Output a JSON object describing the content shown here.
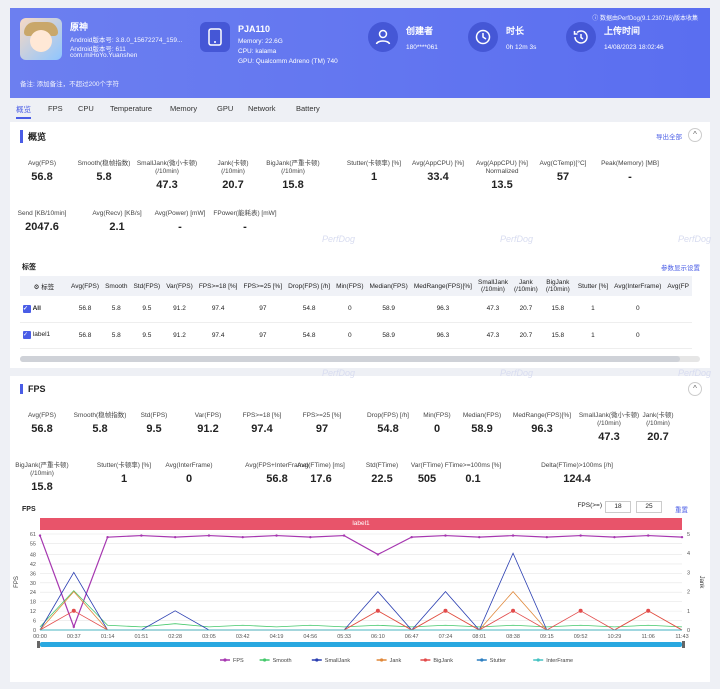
{
  "header": {
    "app": {
      "name": "原神",
      "android_version": "Android版本号: 3.8.0_15672274_159...",
      "android_code": "Android版本号: 611",
      "package": "com.miHoYo.Yuanshen"
    },
    "device": {
      "title": "PJA110",
      "memory": "Memory: 22.6G",
      "cpu": "CPU: kalama",
      "gpu": "GPU: Qualcomm Adreno (TM) 740"
    },
    "creator": {
      "title": "创建者",
      "value": "180****061"
    },
    "duration": {
      "title": "时长",
      "value": "0h 12m 3s"
    },
    "upload": {
      "title": "上传时间",
      "value": "14/08/2023 18:02:46"
    },
    "upload_link": "ⓘ 数据由PerfDog(9.1.230716)版本收集",
    "note": "备注: 添加备注，不超过200个字符"
  },
  "tabs": [
    "概览",
    "FPS",
    "CPU",
    "Temperature",
    "Memory",
    "GPU",
    "Network",
    "Battery"
  ],
  "overview": {
    "title": "概览",
    "export": "导出全部",
    "metrics_row1": [
      {
        "label": "Avg(FPS)",
        "value": "56.8"
      },
      {
        "label": "Smooth(稳帧指数)",
        "value": "5.8"
      },
      {
        "label": "SmallJank(微小卡顿)\n(/10min)",
        "value": "47.3"
      },
      {
        "label": "Jank(卡顿)\n(/10min)",
        "value": "20.7"
      },
      {
        "label": "BigJank(严重卡顿)\n(/10min)",
        "value": "15.8"
      },
      {
        "label": "Stutter(卡顿率) [%]",
        "value": "1"
      },
      {
        "label": "Avg(AppCPU) [%]",
        "value": "33.4"
      },
      {
        "label": "Avg(AppCPU) [%]\nNormalized",
        "value": "13.5"
      },
      {
        "label": "Avg(CTemp)[°C]",
        "value": "57"
      },
      {
        "label": "Peak(Memory) [MB]",
        "value": "-"
      }
    ],
    "metrics_row2": [
      {
        "label": "Send [KB/10min]",
        "value": "2047.6"
      },
      {
        "label": "Avg(Recv) [KB/s]",
        "value": "2.1"
      },
      {
        "label": "Avg(Power) [mW]",
        "value": "-"
      },
      {
        "label": "FPower(能耗表) [mW]",
        "value": "-"
      }
    ],
    "table_title": "标签",
    "table_link": "参数显示设置",
    "columns": [
      "标签",
      "Avg(FPS)",
      "Smooth",
      "Std(FPS)",
      "Var(FPS)",
      "FPS>=18 [%]",
      "FPS>=25 [%]",
      "Drop(FPS) [/h]",
      "Min(FPS)",
      "Median(FPS)",
      "MedRange(FPS)[%]",
      "SmallJank\n(/10min)",
      "Jank\n(/10min)",
      "BigJank\n(/10min)",
      "Stutter [%]",
      "Avg(InterFrame)",
      "Avg(FP"
    ],
    "rows": [
      [
        "All",
        "56.8",
        "5.8",
        "9.5",
        "91.2",
        "97.4",
        "97",
        "54.8",
        "0",
        "58.9",
        "96.3",
        "47.3",
        "20.7",
        "15.8",
        "1",
        "0",
        ""
      ],
      [
        "label1",
        "56.8",
        "5.8",
        "9.5",
        "91.2",
        "97.4",
        "97",
        "54.8",
        "0",
        "58.9",
        "96.3",
        "47.3",
        "20.7",
        "15.8",
        "1",
        "0",
        ""
      ]
    ]
  },
  "fps": {
    "title": "FPS",
    "metrics_row1": [
      {
        "label": "Avg(FPS)",
        "value": "56.8"
      },
      {
        "label": "Smooth(稳帧指数)",
        "value": "5.8"
      },
      {
        "label": "Std(FPS)",
        "value": "9.5"
      },
      {
        "label": "Var(FPS)",
        "value": "91.2"
      },
      {
        "label": "FPS>=18 [%]",
        "value": "97.4"
      },
      {
        "label": "FPS>=25 [%]",
        "value": "97"
      },
      {
        "label": "Drop(FPS) [/h]",
        "value": "54.8"
      },
      {
        "label": "Min(FPS)",
        "value": "0"
      },
      {
        "label": "Median(FPS)",
        "value": "58.9"
      },
      {
        "label": "MedRange(FPS)[%]",
        "value": "96.3"
      },
      {
        "label": "SmallJank(微小卡顿)\n(/10min)",
        "value": "47.3"
      },
      {
        "label": "Jank(卡顿)\n(/10min)",
        "value": "20.7"
      }
    ],
    "metrics_row2": [
      {
        "label": "BigJank(严重卡顿)\n(/10min)",
        "value": "15.8"
      },
      {
        "label": "Stutter(卡顿率) [%]",
        "value": "1"
      },
      {
        "label": "Avg(InterFrame)",
        "value": "0"
      },
      {
        "label": "Avg(FPS+InterFrame)",
        "value": "56.8"
      },
      {
        "label": "Avg(FTime) [ms]",
        "value": "17.6"
      },
      {
        "label": "Std(FTime)",
        "value": "22.5"
      },
      {
        "label": "Var(FTime)",
        "value": "505"
      },
      {
        "label": "FTime>=100ms [%]",
        "value": "0.1"
      },
      {
        "label": "Delta(FTime)>100ms [/h]",
        "value": "124.4"
      }
    ],
    "chart_title": "FPS",
    "fps_threshold_label": "FPS(>=)",
    "fps_threshold_1": "18",
    "fps_threshold_2": "25",
    "reset": "重置",
    "label_bar": "label1"
  },
  "watermark": "PerfDog",
  "chart_data": {
    "type": "line",
    "ylabel": "FPS",
    "y2label": "Jank",
    "ylim": [
      0,
      61
    ],
    "y2lim": [
      0,
      5
    ],
    "yticks": [
      "0",
      "6",
      "12",
      "18",
      "24",
      "30",
      "36",
      "42",
      "48",
      "55",
      "61"
    ],
    "y2ticks": [
      "0",
      "1",
      "2",
      "3",
      "4",
      "5"
    ],
    "x": [
      "00:00",
      "00:37",
      "01:14",
      "01:51",
      "02:28",
      "03:05",
      "03:42",
      "04:19",
      "04:56",
      "05:33",
      "06:10",
      "06:47",
      "07:24",
      "08:01",
      "08:38",
      "09:15",
      "09:52",
      "10:29",
      "11:06",
      "11:43"
    ],
    "series": [
      {
        "name": "FPS",
        "color": "#a637b0",
        "values": [
          60,
          2,
          59,
          60,
          59,
          60,
          59,
          60,
          59,
          60,
          48,
          59,
          60,
          59,
          60,
          59,
          60,
          59,
          60,
          59
        ]
      },
      {
        "name": "Smooth",
        "color": "#44c86b",
        "values": [
          2,
          25,
          3,
          2,
          4,
          2,
          3,
          2,
          3,
          2,
          3,
          2,
          3,
          2,
          3,
          2,
          3,
          2,
          3,
          2
        ]
      },
      {
        "name": "SmallJank",
        "color": "#2a3eb1",
        "values": [
          0,
          3,
          0,
          0,
          1,
          0,
          0,
          0,
          0,
          0,
          2,
          0,
          2,
          0,
          4,
          0,
          0,
          0,
          0,
          0
        ]
      },
      {
        "name": "Jank",
        "color": "#e0883a",
        "values": [
          0,
          2,
          0,
          0,
          0,
          0,
          0,
          0,
          0,
          0,
          1,
          0,
          1,
          0,
          2,
          0,
          0,
          0,
          1,
          0
        ]
      },
      {
        "name": "BigJank",
        "color": "#e24b4b",
        "values": [
          0,
          1,
          0,
          0,
          0,
          0,
          0,
          0,
          0,
          0,
          1,
          0,
          1,
          0,
          1,
          0,
          1,
          0,
          1,
          0
        ]
      },
      {
        "name": "Stutter",
        "color": "#2d7fc1",
        "values": [
          0,
          0,
          0,
          0,
          0,
          0,
          0,
          0,
          0,
          0,
          0,
          0,
          0,
          0,
          0,
          0,
          0,
          0,
          0,
          0
        ]
      },
      {
        "name": "InterFrame",
        "color": "#45c2c2",
        "values": [
          0,
          0,
          0,
          0,
          0,
          0,
          0,
          0,
          0,
          0,
          0,
          0,
          0,
          0,
          0,
          0,
          0,
          0,
          0,
          0
        ]
      }
    ]
  }
}
